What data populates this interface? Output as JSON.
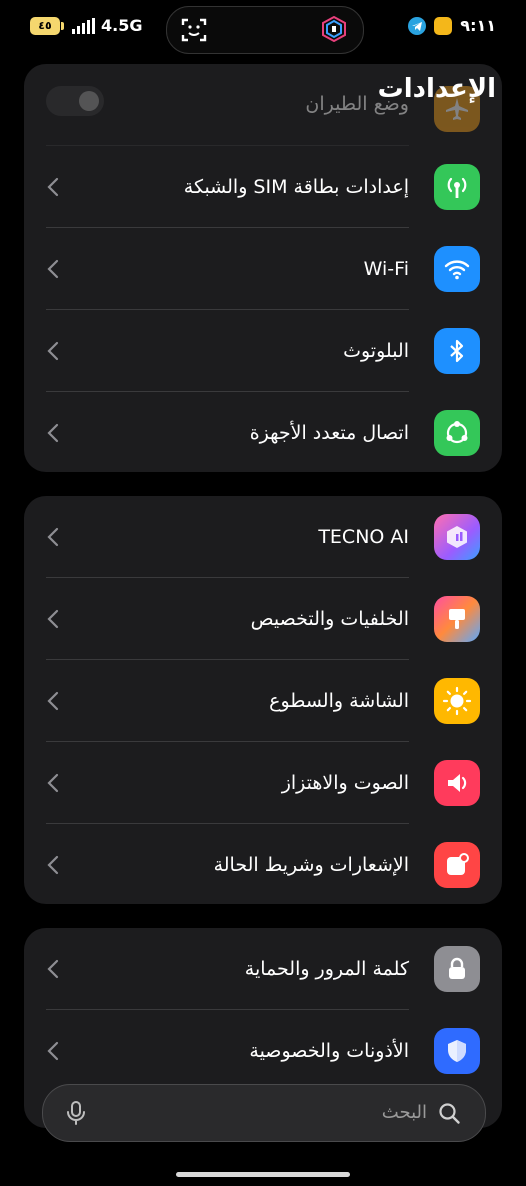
{
  "status_bar": {
    "battery": "٤٥",
    "network": "4.5G",
    "time": "٩:١١"
  },
  "header": {
    "title": "الإعدادات"
  },
  "groups": [
    {
      "items": [
        {
          "label": "وضع الطيران",
          "icon": "airplane-icon",
          "color": "#f0a020",
          "control": "toggle-off"
        },
        {
          "label": "إعدادات بطاقة SIM والشبكة",
          "icon": "antenna-icon",
          "color": "#34c759"
        },
        {
          "label": "Wi-Fi",
          "icon": "wifi-icon",
          "color": "#1e90ff"
        },
        {
          "label": "البلوتوث",
          "icon": "bluetooth-icon",
          "color": "#1e90ff"
        },
        {
          "label": "اتصال متعدد الأجهزة",
          "icon": "multi-device-icon",
          "color": "#34c759"
        }
      ]
    },
    {
      "items": [
        {
          "label": "TECNO AI",
          "icon": "tecno-ai-icon",
          "color": "#b15cff"
        },
        {
          "label": "الخلفيات والتخصيص",
          "icon": "paint-brush-icon",
          "color": "#ff6b6b"
        },
        {
          "label": "الشاشة والسطوع",
          "icon": "sun-icon",
          "color": "#ffb800"
        },
        {
          "label": "الصوت والاهتزاز",
          "icon": "speaker-icon",
          "color": "#ff3b5c"
        },
        {
          "label": "الإشعارات وشريط الحالة",
          "icon": "notification-icon",
          "color": "#ff4545"
        }
      ]
    },
    {
      "items": [
        {
          "label": "كلمة المرور والحماية",
          "icon": "lock-icon",
          "color": "#8e8e93"
        },
        {
          "label": "الأذونات والخصوصية",
          "icon": "shield-icon",
          "color": "#2f6bff"
        }
      ]
    }
  ],
  "search": {
    "placeholder": "البحث"
  }
}
